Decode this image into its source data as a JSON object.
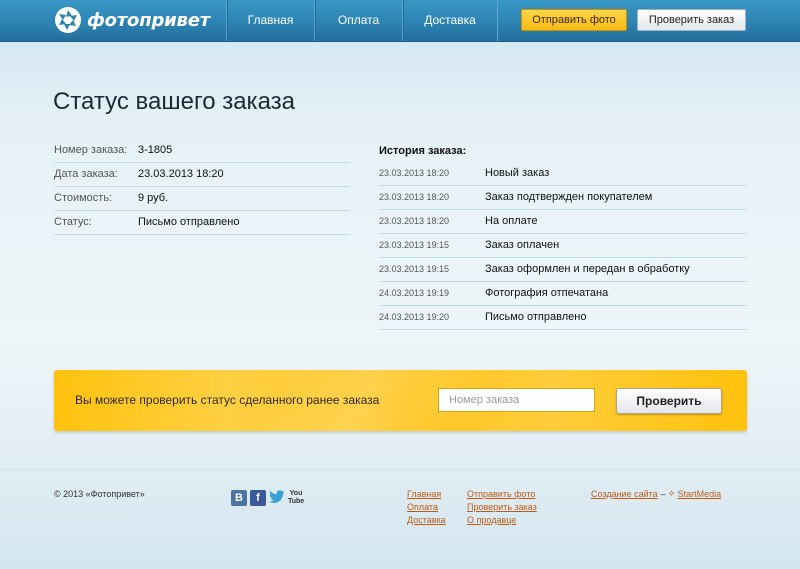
{
  "header": {
    "logo_text": "фотопривет",
    "nav": [
      "Главная",
      "Оплата",
      "Доставка"
    ],
    "send_photo_button": "Отправить фото",
    "check_order_button": "Проверить заказ",
    "colors": {
      "header": "#2d83b2",
      "accent": "#f7bb12"
    }
  },
  "page": {
    "title": "Статус вашего заказа"
  },
  "order": {
    "rows": [
      {
        "label": "Номер заказа:",
        "value": "3-1805"
      },
      {
        "label": "Дата заказа:",
        "value": "23.03.2013 18:20"
      },
      {
        "label": "Стоимость:",
        "value": "9 руб."
      },
      {
        "label": "Статус:",
        "value": "Письмо отправлено"
      }
    ]
  },
  "history": {
    "title": "История заказа:",
    "rows": [
      {
        "date": "23.03.2013 18:20",
        "event": "Новый заказ"
      },
      {
        "date": "23.03.2013 18:20",
        "event": "Заказ подтвержден покупателем"
      },
      {
        "date": "23.03.2013 18:20",
        "event": "На оплате"
      },
      {
        "date": "23.03.2013 19:15",
        "event": "Заказ оплачен"
      },
      {
        "date": "23.03.2013 19:15",
        "event": "Заказ оформлен и передан в обработку"
      },
      {
        "date": "24.03.2013 19:19",
        "event": "Фотография отпечатана"
      },
      {
        "date": "24.03.2013 19:20",
        "event": "Письмо отправлено"
      }
    ]
  },
  "check_banner": {
    "text": "Вы можете проверить статус сделанного ранее заказа",
    "input_placeholder": "Номер заказа",
    "input_value": "",
    "button_label": "Проверить"
  },
  "footer": {
    "copyright": "© 2013 «Фотопривет»",
    "social": [
      "vk-icon",
      "facebook-icon",
      "twitter-icon",
      "youtube-icon"
    ],
    "youtube_text": "You Tube",
    "links_col1": [
      "Главная",
      "Оплата",
      "Доставка"
    ],
    "links_col2": [
      "Отправить фото",
      "Проверить заказ",
      "О продавце"
    ],
    "credit_link": "Создание сайта",
    "credit_separator": "–",
    "credit_company": "StartMedia"
  }
}
